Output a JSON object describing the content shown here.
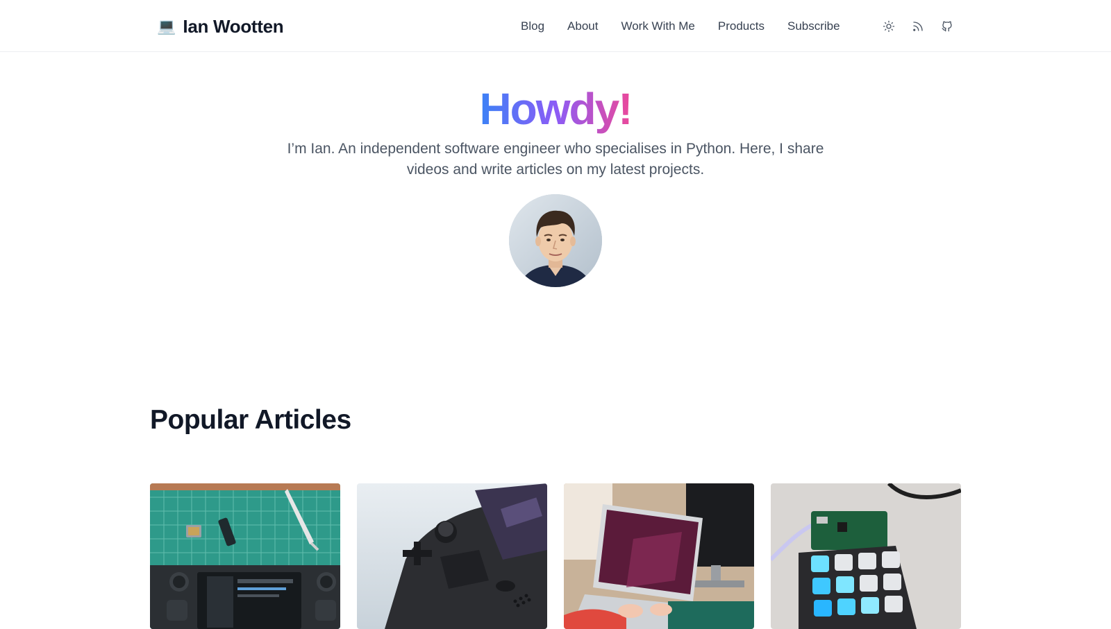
{
  "brand": {
    "emoji": "💻",
    "name": "Ian Wootten"
  },
  "nav": {
    "links": [
      {
        "label": "Blog"
      },
      {
        "label": "About"
      },
      {
        "label": "Work With Me"
      },
      {
        "label": "Products"
      },
      {
        "label": "Subscribe"
      }
    ],
    "icons": [
      "sun-icon",
      "rss-icon",
      "github-icon"
    ]
  },
  "hero": {
    "title": "Howdy!",
    "intro": "I’m Ian. An independent software engineer who specialises in Python. Here, I share videos and write articles on my latest projects.",
    "gradient": [
      "#3b82f6",
      "#8b5cf6",
      "#ec4899"
    ]
  },
  "popular": {
    "title": "Popular Articles",
    "cards": [
      {
        "thumbnail": "steam-deck-ssd-upgrade-photo"
      },
      {
        "thumbnail": "steam-deck-closeup-photo"
      },
      {
        "thumbnail": "laptop-typing-photo"
      },
      {
        "thumbnail": "macropad-keyboard-photo"
      }
    ]
  },
  "colors": {
    "text": "#111827",
    "nav_text": "#374151",
    "muted": "#4b5563",
    "border": "#eceef1"
  }
}
